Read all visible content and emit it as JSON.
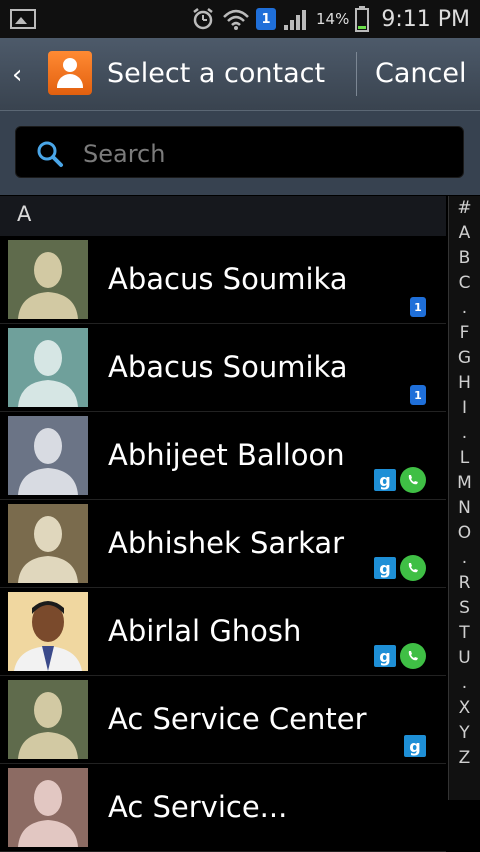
{
  "status": {
    "battery": "14%",
    "time": "9:11 PM",
    "sim_badge": "1"
  },
  "header": {
    "title": "Select a contact",
    "cancel": "Cancel"
  },
  "search": {
    "placeholder": "Search"
  },
  "section": "A",
  "contacts": [
    {
      "name": "Abacus Soumika",
      "badges": [
        "one"
      ],
      "avatar": {
        "bg": "#5f6b4c",
        "fg": "#d2c9a3"
      }
    },
    {
      "name": "Abacus Soumika",
      "badges": [
        "one"
      ],
      "avatar": {
        "bg": "#6fa09b",
        "fg": "#d6e6e4"
      }
    },
    {
      "name": "Abhijeet Balloon",
      "badges": [
        "google",
        "whatsapp"
      ],
      "avatar": {
        "bg": "#6b7486",
        "fg": "#d8dbe2"
      }
    },
    {
      "name": "Abhishek Sarkar",
      "badges": [
        "google",
        "whatsapp"
      ],
      "avatar": {
        "bg": "#7a6b4d",
        "fg": "#e0d7bd"
      }
    },
    {
      "name": "Abirlal Ghosh",
      "badges": [
        "google",
        "whatsapp"
      ],
      "avatar": {
        "bg": "#f0d7a0",
        "fg": "#2a2a2a",
        "photo": true
      }
    },
    {
      "name": "Ac Service Center",
      "badges": [
        "google"
      ],
      "avatar": {
        "bg": "#5f6b4c",
        "fg": "#d2c9a3"
      }
    },
    {
      "name": "Ac Service...",
      "badges": [],
      "avatar": {
        "bg": "#8c6b63",
        "fg": "#e2c7c2"
      }
    }
  ],
  "index_letters": [
    "#",
    "A",
    "B",
    "C",
    ".",
    "F",
    "G",
    "H",
    "I",
    ".",
    "L",
    "M",
    "N",
    "O",
    ".",
    "R",
    "S",
    "T",
    "U",
    ".",
    "X",
    "Y",
    "Z"
  ]
}
